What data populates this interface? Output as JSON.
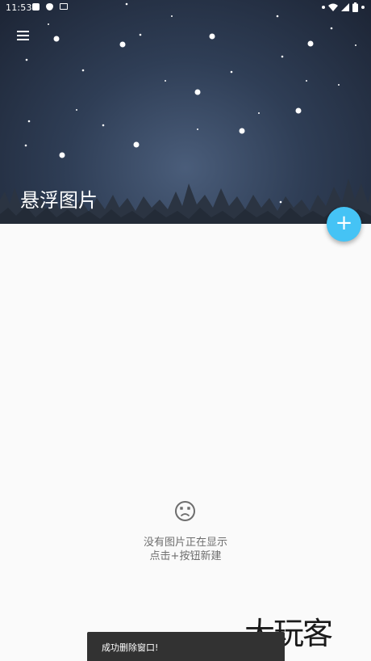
{
  "status_bar": {
    "time": "11:53"
  },
  "header": {
    "title": "悬浮图片",
    "menu_icon": "hamburger-menu-icon"
  },
  "fab": {
    "label": "+",
    "icon": "add-icon",
    "color": "#45c3f5"
  },
  "empty_state": {
    "icon": "sad-face-icon",
    "line1": "没有图片正在显示",
    "line2": "点击+按钮新建"
  },
  "watermark": {
    "text": "大玩客"
  },
  "snackbar": {
    "message": "成功删除窗口!"
  }
}
